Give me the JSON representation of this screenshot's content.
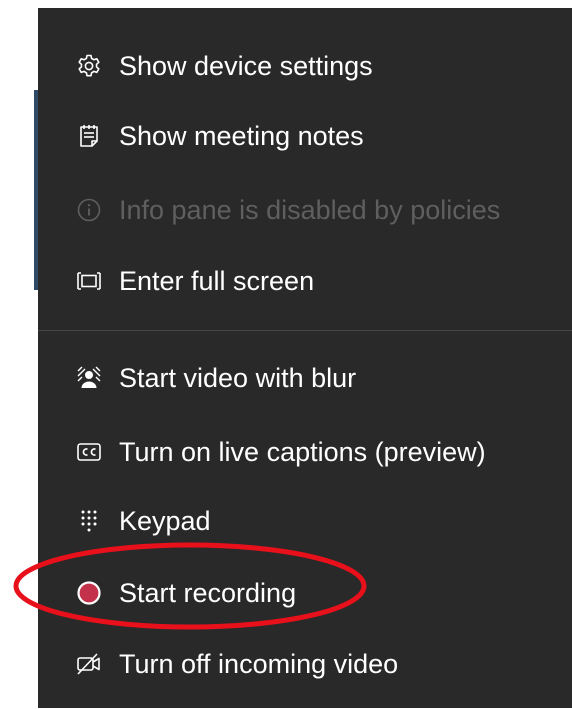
{
  "menu": {
    "items": [
      {
        "id": "device-settings",
        "label": "Show device settings",
        "icon": "gear-icon",
        "disabled": false
      },
      {
        "id": "meeting-notes",
        "label": "Show meeting notes",
        "icon": "notes-icon",
        "disabled": false
      },
      {
        "id": "info-pane",
        "label": "Info pane is disabled by policies",
        "icon": "info-icon",
        "disabled": true
      },
      {
        "id": "full-screen",
        "label": "Enter full screen",
        "icon": "fullscreen-icon",
        "disabled": false
      },
      {
        "id": "video-blur",
        "label": "Start video with blur",
        "icon": "blur-background-icon",
        "disabled": false
      },
      {
        "id": "live-captions",
        "label": "Turn on live captions (preview)",
        "icon": "closed-captions-icon",
        "disabled": false
      },
      {
        "id": "keypad",
        "label": "Keypad",
        "icon": "keypad-icon",
        "disabled": false
      },
      {
        "id": "start-recording",
        "label": "Start recording",
        "icon": "record-icon",
        "disabled": false
      },
      {
        "id": "incoming-video",
        "label": "Turn off incoming video",
        "icon": "video-off-icon",
        "disabled": false
      }
    ]
  },
  "colors": {
    "menu_background": "#292929",
    "text": "#ffffff",
    "disabled_text": "#5f5f5f",
    "divider": "#454545",
    "record_dot": "#c4314b",
    "annotation": "#e8101a"
  },
  "annotation": {
    "shape": "ellipse",
    "highlights": "start-recording"
  }
}
